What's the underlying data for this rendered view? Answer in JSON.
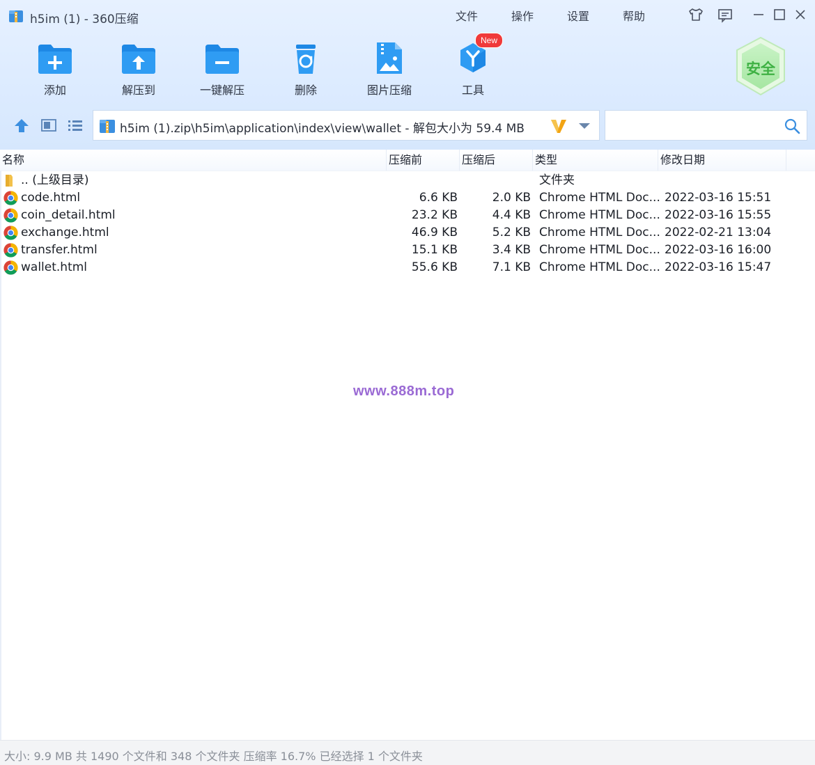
{
  "window": {
    "title": "h5im (1) - 360压缩",
    "menus": [
      "文件",
      "操作",
      "设置",
      "帮助"
    ],
    "icons": [
      "skin-icon",
      "feedback-icon",
      "minimize-icon",
      "maximize-icon",
      "close-icon"
    ]
  },
  "toolbar": {
    "buttons": [
      {
        "label": "添加",
        "icon": "add-folder-icon"
      },
      {
        "label": "解压到",
        "icon": "extract-to-icon"
      },
      {
        "label": "一键解压",
        "icon": "one-click-extract-icon"
      },
      {
        "label": "删除",
        "icon": "delete-icon"
      },
      {
        "label": "图片压缩",
        "icon": "image-compress-icon"
      },
      {
        "label": "工具",
        "icon": "tools-icon"
      }
    ],
    "new_badge": "New",
    "security_badge": "安全"
  },
  "navigation": {
    "path": "h5im (1).zip\\h5im\\application\\index\\view\\wallet - 解包大小为 59.4 MB",
    "search_value": ""
  },
  "table": {
    "columns": [
      "名称",
      "压缩前",
      "压缩后",
      "类型",
      "修改日期"
    ],
    "parent_row": {
      "name": ".. (上级目录)",
      "type": "文件夹"
    },
    "rows": [
      {
        "name": "code.html",
        "original": "6.6 KB",
        "compressed": "2.0 KB",
        "type": "Chrome HTML Doc...",
        "modified": "2022-03-16 15:51"
      },
      {
        "name": "coin_detail.html",
        "original": "23.2 KB",
        "compressed": "4.4 KB",
        "type": "Chrome HTML Doc...",
        "modified": "2022-03-16 15:55"
      },
      {
        "name": "exchange.html",
        "original": "46.9 KB",
        "compressed": "5.2 KB",
        "type": "Chrome HTML Doc...",
        "modified": "2022-02-21 13:04"
      },
      {
        "name": "transfer.html",
        "original": "15.1 KB",
        "compressed": "3.4 KB",
        "type": "Chrome HTML Doc...",
        "modified": "2022-03-16 16:00"
      },
      {
        "name": "wallet.html",
        "original": "55.6 KB",
        "compressed": "7.1 KB",
        "type": "Chrome HTML Doc...",
        "modified": "2022-03-16 15:47"
      }
    ]
  },
  "watermark": "www.888m.top",
  "status": {
    "text": "大小: 9.9 MB 共 1490 个文件和 348 个文件夹 压缩率 16.7% 已经选择 1 个文件夹"
  },
  "colors": {
    "accent_blue": "#2a8be8",
    "header_bg": "#dcebff",
    "security_green": "#58c35a",
    "badge_red": "#f03a3a"
  }
}
